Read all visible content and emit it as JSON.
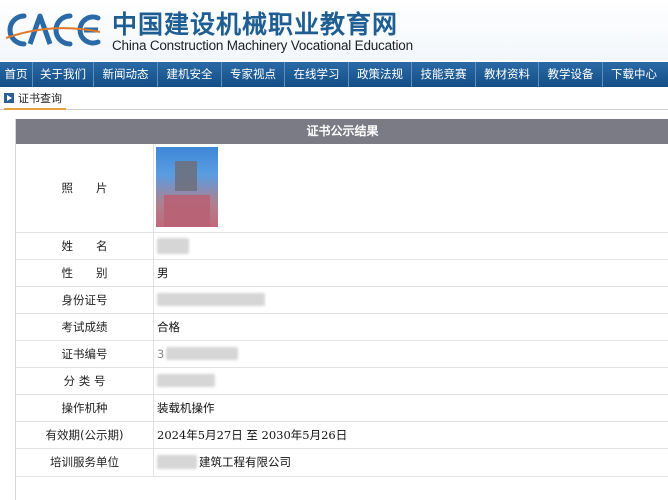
{
  "header": {
    "logo_text": "CACE",
    "title_cn": "中国建设机械职业教育网",
    "title_en": "China Construction Machinery Vocational Education"
  },
  "nav": {
    "items": [
      {
        "label": "首页"
      },
      {
        "label": "关于我们"
      },
      {
        "label": "新闻动态"
      },
      {
        "label": "建机安全"
      },
      {
        "label": "专家视点"
      },
      {
        "label": "在线学习"
      },
      {
        "label": "政策法规"
      },
      {
        "label": "技能竞赛"
      },
      {
        "label": "教材资料"
      },
      {
        "label": "教学设备"
      },
      {
        "label": "下载中心"
      }
    ]
  },
  "breadcrumb": {
    "label": "证书查询"
  },
  "result": {
    "title": "证书公示结果",
    "rows": [
      {
        "label": "照　　片",
        "value": ""
      },
      {
        "label": "姓　　名",
        "value": ""
      },
      {
        "label": "性　　别",
        "value": "男"
      },
      {
        "label": "身份证号",
        "value": ""
      },
      {
        "label": "考试成绩",
        "value": "合格"
      },
      {
        "label": "证书编号",
        "value": "3"
      },
      {
        "label": "分 类 号",
        "value": ""
      },
      {
        "label": "操作机种",
        "value": "装载机操作"
      },
      {
        "label": "有效期(公示期)",
        "value": "2024年5月27日 至 2030年5月26日"
      },
      {
        "label": "培训服务单位",
        "value": "建筑工程有限公司"
      }
    ]
  },
  "colors": {
    "brand_blue": "#1f5e92",
    "nav_blue": "#144f86",
    "title_bar_gray": "#7b7b85",
    "crumb_accent": "#e6a23c"
  }
}
